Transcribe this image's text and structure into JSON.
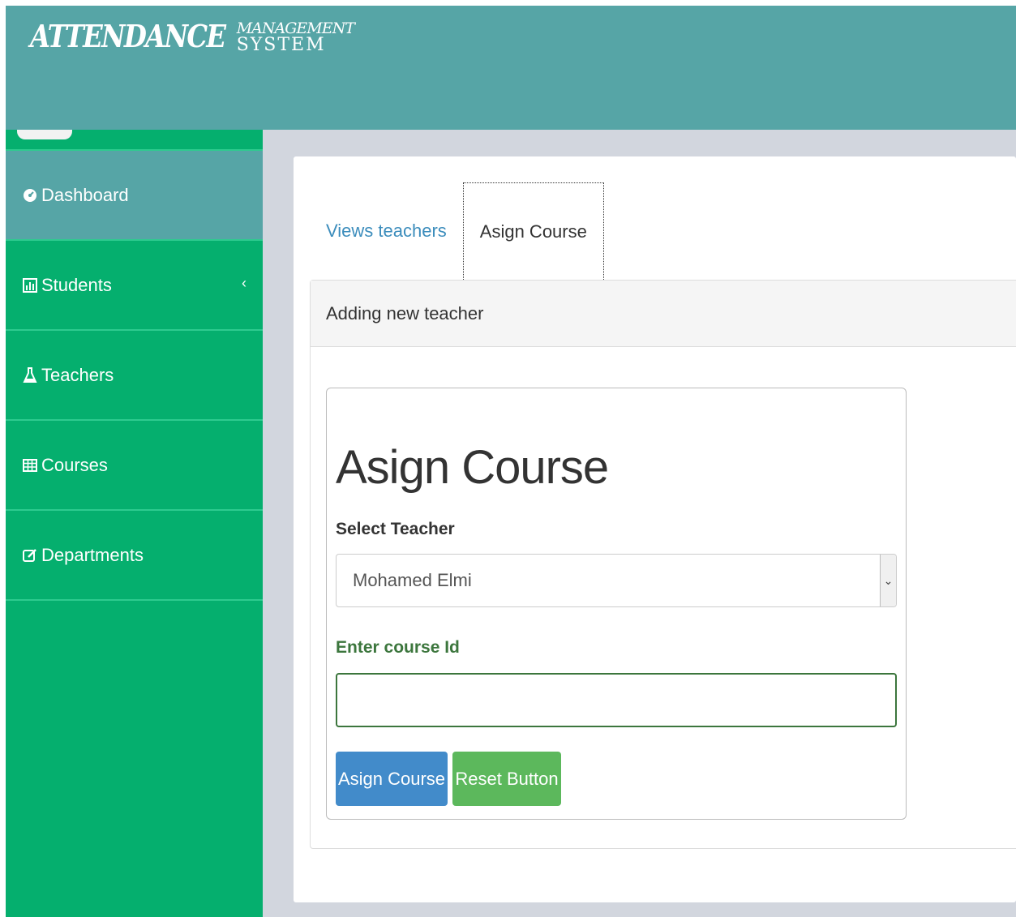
{
  "header": {
    "logo_main": "ATTENDANCE",
    "logo_top": "MANAGEMENT",
    "logo_bottom": "SYSTEM"
  },
  "sidebar": {
    "items": [
      {
        "label": "Dashboard",
        "icon": "dashboard-icon",
        "active": true
      },
      {
        "label": "Students",
        "icon": "bar-chart-icon",
        "has_submenu": true
      },
      {
        "label": "Teachers",
        "icon": "flask-icon"
      },
      {
        "label": "Courses",
        "icon": "table-icon"
      },
      {
        "label": "Departments",
        "icon": "edit-icon"
      }
    ]
  },
  "tabs": [
    {
      "label": "Views teachers",
      "active": false
    },
    {
      "label": "Asign Course",
      "active": true
    }
  ],
  "panel": {
    "heading": "Adding new teacher"
  },
  "form": {
    "title": "Asign Course",
    "teacher_label": "Select Teacher",
    "teacher_selected": "Mohamed Elmi",
    "course_label": "Enter course Id",
    "course_value": "",
    "submit_label": "Asign Course",
    "reset_label": "Reset Button"
  },
  "colors": {
    "header": "#56a5a6",
    "sidebar": "#05af6e",
    "primary": "#428bca",
    "success": "#5cb85c"
  }
}
